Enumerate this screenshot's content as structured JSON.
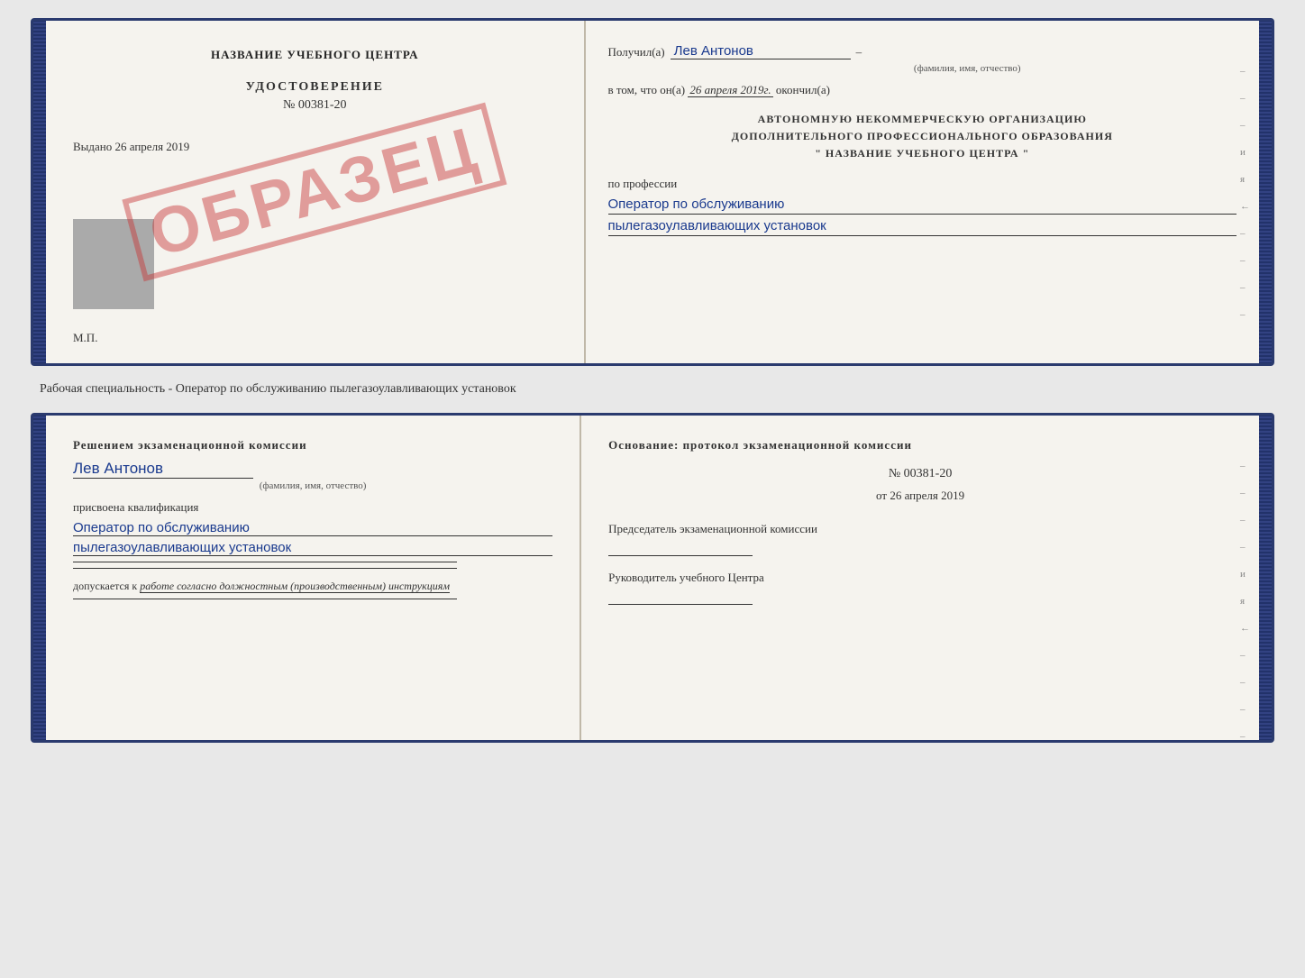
{
  "top_cert": {
    "left": {
      "school_name": "НАЗВАНИЕ УЧЕБНОГО ЦЕНТРА",
      "cert_title": "УДОСТОВЕРЕНИЕ",
      "cert_number": "№ 00381-20",
      "issued_label": "Выдано",
      "issued_date": "26 апреля 2019",
      "mp_label": "М.П.",
      "stamp_text": "ОБРАЗЕЦ",
      "photo_alt": "фото"
    },
    "right": {
      "received_label": "Получил(а)",
      "received_name": "Лев Антонов",
      "fio_subtitle": "(фамилия, имя, отчество)",
      "completed_prefix": "в том, что он(а)",
      "completed_date": "26 апреля 2019г.",
      "completed_suffix": "окончил(а)",
      "org_line1": "АВТОНОМНУЮ НЕКОММЕРЧЕСКУЮ ОРГАНИЗАЦИЮ",
      "org_line2": "ДОПОЛНИТЕЛЬНОГО ПРОФЕССИОНАЛЬНОГО ОБРАЗОВАНИЯ",
      "org_line3": "\"  НАЗВАНИЕ УЧЕБНОГО ЦЕНТРА  \"",
      "profession_label": "по профессии",
      "profession_line1": "Оператор по обслуживанию",
      "profession_line2": "пылегазоулавливающих установок",
      "right_marks": [
        "–",
        "–",
        "–",
        "и",
        "я",
        "←",
        "–",
        "–",
        "–",
        "–"
      ]
    }
  },
  "separator": {
    "text": "Рабочая специальность - Оператор по обслуживанию пылегазоулавливающих установок"
  },
  "bottom_cert": {
    "left": {
      "decision_text": "Решением экзаменационной комиссии",
      "person_name": "Лев Антонов",
      "fio_label": "(фамилия, имя, отчество)",
      "qualification_label": "присвоена квалификация",
      "qualification_line1": "Оператор по обслуживанию",
      "qualification_line2": "пылегазоулавливающих установок",
      "allowed_prefix": "допускается к",
      "allowed_italic": "работе согласно должностным (производственным) инструкциям"
    },
    "right": {
      "osnov_label": "Основание: протокол экзаменационной комиссии",
      "protocol_number": "№  00381-20",
      "protocol_date_prefix": "от",
      "protocol_date": "26 апреля 2019",
      "chairman_label": "Председатель экзаменационной комиссии",
      "director_label": "Руководитель учебного Центра",
      "right_marks": [
        "–",
        "–",
        "–",
        "–",
        "и",
        "я",
        "←",
        "–",
        "–",
        "–",
        "–"
      ]
    }
  }
}
